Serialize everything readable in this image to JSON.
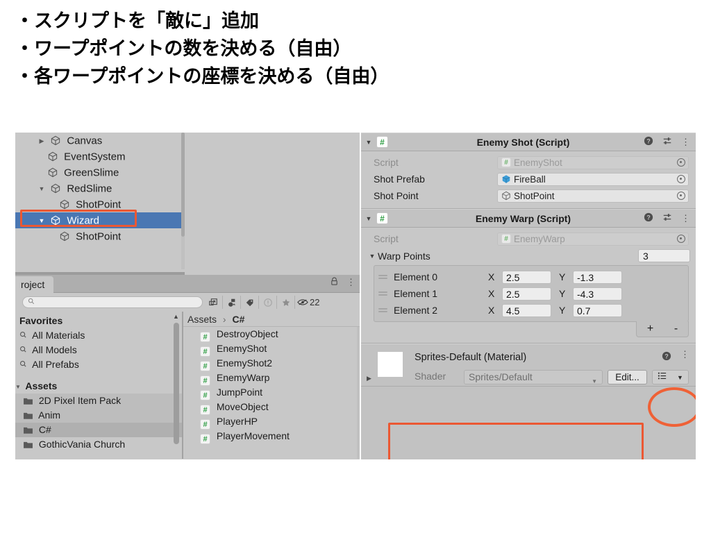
{
  "slide": {
    "bullets": [
      "・スクリプトを「敵に」追加",
      "・ワープポイントの数を決める（自由）",
      "・各ワープポイントの座標を決める（自由）"
    ]
  },
  "hierarchy": {
    "rows": [
      {
        "label": "Canvas",
        "indent": 1,
        "foldout": "▶",
        "selected": false
      },
      {
        "label": "EventSystem",
        "indent": 1,
        "foldout": "",
        "selected": false
      },
      {
        "label": "GreenSlime",
        "indent": 1,
        "foldout": "",
        "selected": false
      },
      {
        "label": "RedSlime",
        "indent": 1,
        "foldout": "▼",
        "selected": false
      },
      {
        "label": "ShotPoint",
        "indent": 2,
        "foldout": "",
        "selected": false
      },
      {
        "label": "Wizard",
        "indent": 1,
        "foldout": "▼",
        "selected": true
      },
      {
        "label": "ShotPoint",
        "indent": 2,
        "foldout": "",
        "selected": false
      }
    ],
    "selection_color": "#4a77b3"
  },
  "project": {
    "tab_label": "roject",
    "lock_icon": "lock-icon",
    "menu_icon": "kebab-menu-icon",
    "search": {
      "placeholder": "",
      "value": "",
      "icon": "search-icon"
    },
    "toolbar_buttons": [
      "type-filter-icon",
      "label-filter-icon",
      "warning-filter-icon",
      "favorite-star-icon"
    ],
    "hidden_count": "22",
    "hidden_icon": "hidden-eye-icon",
    "tree": [
      {
        "label": "Favorites",
        "kind": "header",
        "selected": false
      },
      {
        "label": "All Materials",
        "kind": "search",
        "selected": false
      },
      {
        "label": "All Models",
        "kind": "search",
        "selected": false
      },
      {
        "label": "All Prefabs",
        "kind": "search",
        "selected": false
      },
      {
        "label": "Assets",
        "kind": "header2",
        "selected": false
      },
      {
        "label": "2D Pixel Item Pack",
        "kind": "folder",
        "selected": false
      },
      {
        "label": "Anim",
        "kind": "folder",
        "selected": false
      },
      {
        "label": "C#",
        "kind": "folder",
        "selected": true
      },
      {
        "label": "GothicVania Church",
        "kind": "folder",
        "selected": false
      }
    ],
    "breadcrumb": {
      "root": "Assets",
      "separator": "›",
      "current": "C#"
    },
    "assets": [
      "DestroyObject",
      "EnemyShot",
      "EnemyShot2",
      "EnemyWarp",
      "JumpPoint",
      "MoveObject",
      "PlayerHP",
      "PlayerMovement"
    ]
  },
  "inspector": {
    "enemy_shot": {
      "title": "Enemy Shot (Script)",
      "foldout": "▼",
      "icon": "cs-script-icon",
      "help_icon": "help-icon",
      "settings_icon": "preset-settings-icon",
      "menu_icon": "kebab-menu-icon",
      "rows": [
        {
          "label": "Script",
          "value": "EnemyShot",
          "icon": "cs-script-icon",
          "dim": true
        },
        {
          "label": "Shot Prefab",
          "value": "FireBall",
          "icon": "prefab-cube-icon",
          "dim": false
        },
        {
          "label": "Shot Point",
          "value": "ShotPoint",
          "icon": "gameobject-icon",
          "dim": false
        }
      ]
    },
    "enemy_warp": {
      "title": "Enemy Warp (Script)",
      "foldout": "▼",
      "icon": "cs-script-icon",
      "help_icon": "help-icon",
      "settings_icon": "preset-settings-icon",
      "menu_icon": "kebab-menu-icon",
      "script_row": {
        "label": "Script",
        "value": "EnemyWarp",
        "icon": "cs-script-icon"
      },
      "array_label": "Warp Points",
      "array_foldout": "▼",
      "array_size": "3",
      "elements": [
        {
          "label": "Element 0",
          "x_label": "X",
          "x": "2.5",
          "y_label": "Y",
          "y": "-1.3"
        },
        {
          "label": "Element 1",
          "x_label": "X",
          "x": "2.5",
          "y_label": "Y",
          "y": "-4.3"
        },
        {
          "label": "Element 2",
          "x_label": "X",
          "x": "4.5",
          "y_label": "Y",
          "y": "0.7"
        }
      ],
      "add_label": "+",
      "remove_label": "-"
    },
    "material": {
      "title": "Sprites-Default (Material)",
      "swatch_color": "#ffffff",
      "expand_arrow": "▶",
      "shader_label": "Shader",
      "shader_value": "Sprites/Default",
      "edit_label": "Edit...",
      "preset_icon": "preset-list-icon",
      "preset_caret": "▼",
      "help_icon": "help-icon",
      "menu_icon": "kebab-menu-icon"
    }
  },
  "annotations": {
    "highlight_color": "#eb5833",
    "circle_color": "#ef6136",
    "boxes": [
      "wizard-row-highlight",
      "warp-elements-highlight"
    ],
    "circles": [
      "warp-size-circle"
    ]
  }
}
